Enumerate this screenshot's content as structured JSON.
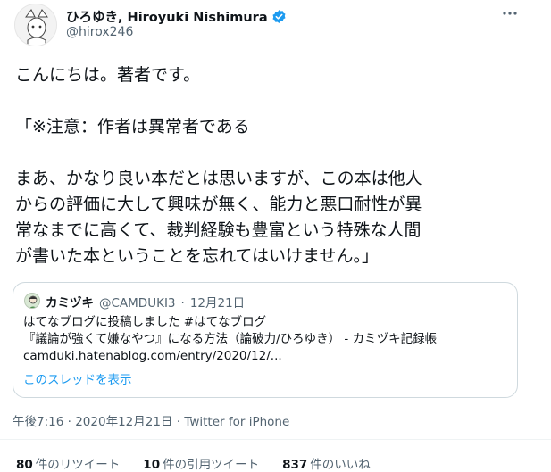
{
  "author": {
    "display_name": "ひろゆき, Hiroyuki Nishimura",
    "handle": "@hirox246",
    "verified_icon": "verified-badge-icon"
  },
  "tweet": {
    "lines": [
      "こんにちは。著者です。",
      "",
      "「※注意：作者は異常者である",
      "",
      "まあ、かなり良い本だとは思いますが、この本は他人",
      "からの評価に大して興味が無く、能力と悪口耐性が異",
      "常なまでに高くて、裁判経験も豊富という特殊な人間",
      "が書いた本ということを忘れてはいけません。」"
    ]
  },
  "quoted": {
    "name": "カミヅキ",
    "handle": "@CAMDUKI3",
    "date": "12月21日",
    "lines": [
      "はてなブログに投稿しました #はてなブログ",
      "『議論が強くて嫌なやつ』になる方法（論破力/ひろゆき） - カミヅキ記録帳",
      "camduki.hatenablog.com/entry/2020/12/..."
    ],
    "thread_link": "このスレッドを表示"
  },
  "meta": {
    "time": "午後7:16",
    "date": "2020年12月21日",
    "source": "Twitter for iPhone"
  },
  "stats": {
    "retweets_count": "80",
    "retweets_label": "件のリツイート",
    "quotes_count": "10",
    "quotes_label": "件の引用ツイート",
    "likes_count": "837",
    "likes_label": "件のいいね"
  },
  "colors": {
    "accent": "#1d9bf0",
    "secondary_text": "#536471",
    "border": "#cfd9de"
  }
}
